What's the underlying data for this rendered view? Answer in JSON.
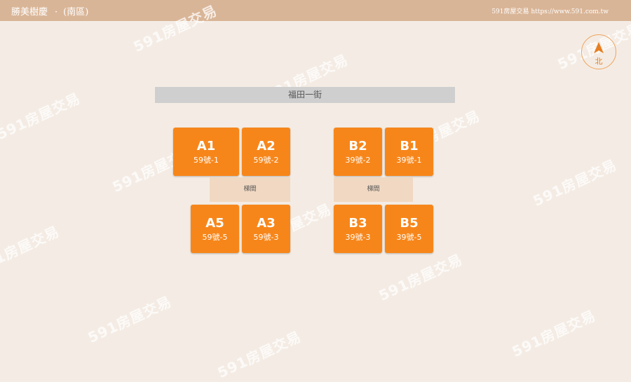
{
  "header": {
    "title": "勝美樹慶",
    "separator": "·",
    "zone": "(南區)",
    "site": "591房屋交易 https://www.591.com.tw"
  },
  "compass": {
    "label": "北"
  },
  "street": {
    "name": "福田一街"
  },
  "units": {
    "a1": {
      "code": "A1",
      "number": "59號-1"
    },
    "a2": {
      "code": "A2",
      "number": "59號-2"
    },
    "a5": {
      "code": "A5",
      "number": "59號-5"
    },
    "a3": {
      "code": "A3",
      "number": "59號-3"
    },
    "b2": {
      "code": "B2",
      "number": "39號-2"
    },
    "b1": {
      "code": "B1",
      "number": "39號-1"
    },
    "b3": {
      "code": "B3",
      "number": "39號-3"
    },
    "b5": {
      "code": "B5",
      "number": "39號-5"
    }
  },
  "stairs": {
    "label": "梯間"
  },
  "watermark": {
    "text": "591房屋交易"
  },
  "colors": {
    "unit": "#f7861a",
    "header": "#d9b597",
    "background": "#f4ece4",
    "compass": "#f0a35e"
  }
}
